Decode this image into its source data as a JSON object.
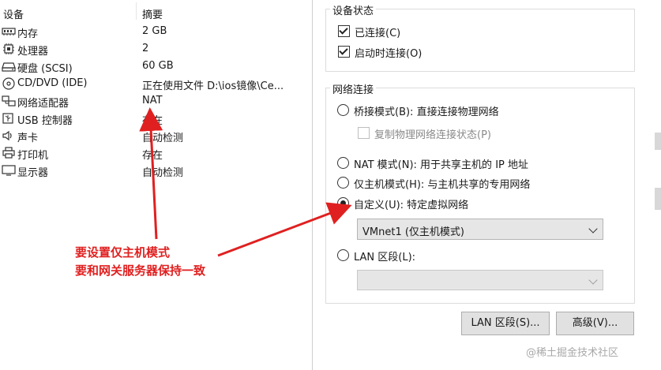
{
  "hardware": {
    "col_device": "设备",
    "col_summary": "摘要",
    "rows": [
      {
        "icon": "memory-icon",
        "device": "内存",
        "summary": "2 GB"
      },
      {
        "icon": "cpu-icon",
        "device": "处理器",
        "summary": "2"
      },
      {
        "icon": "hard-disk-icon",
        "device": "硬盘 (SCSI)",
        "summary": "60 GB"
      },
      {
        "icon": "cd-dvd-icon",
        "device": "CD/DVD (IDE)",
        "summary": "正在使用文件 D:\\ios镜像\\Ce..."
      },
      {
        "icon": "network-adapter-icon",
        "device": "网络适配器",
        "summary": "NAT"
      },
      {
        "icon": "usb-icon",
        "device": "USB 控制器",
        "summary": "存在"
      },
      {
        "icon": "sound-icon",
        "device": "声卡",
        "summary": "自动检测"
      },
      {
        "icon": "printer-icon",
        "device": "打印机",
        "summary": "存在"
      },
      {
        "icon": "display-icon",
        "device": "显示器",
        "summary": "自动检测"
      }
    ]
  },
  "device_status": {
    "title": "设备状态",
    "connected": {
      "label": "已连接(C)",
      "checked": true
    },
    "connect_at_power_on": {
      "label": "启动时连接(O)",
      "checked": true
    }
  },
  "network_connection": {
    "title": "网络连接",
    "bridged": {
      "label": "桥接模式(B): 直接连接物理网络",
      "selected": false
    },
    "replicate": {
      "label": "复制物理网络连接状态(P)",
      "checked": false
    },
    "nat": {
      "label": "NAT 模式(N): 用于共享主机的 IP 地址",
      "selected": false
    },
    "host_only": {
      "label": "仅主机模式(H): 与主机共享的专用网络",
      "selected": false
    },
    "custom": {
      "label": "自定义(U): 特定虚拟网络",
      "selected": true
    },
    "custom_select_value": "VMnet1 (仅主机模式)",
    "lan_segment": {
      "label": "LAN 区段(L):",
      "selected": false
    },
    "lan_select_value": ""
  },
  "buttons": {
    "lan_segments": "LAN 区段(S)...",
    "advanced": "高级(V)..."
  },
  "annotation": {
    "line1": "要设置仅主机模式",
    "line2": "要和网关服务器保持一致",
    "color": "#e02020"
  },
  "watermark": "@稀土掘金技术社区"
}
